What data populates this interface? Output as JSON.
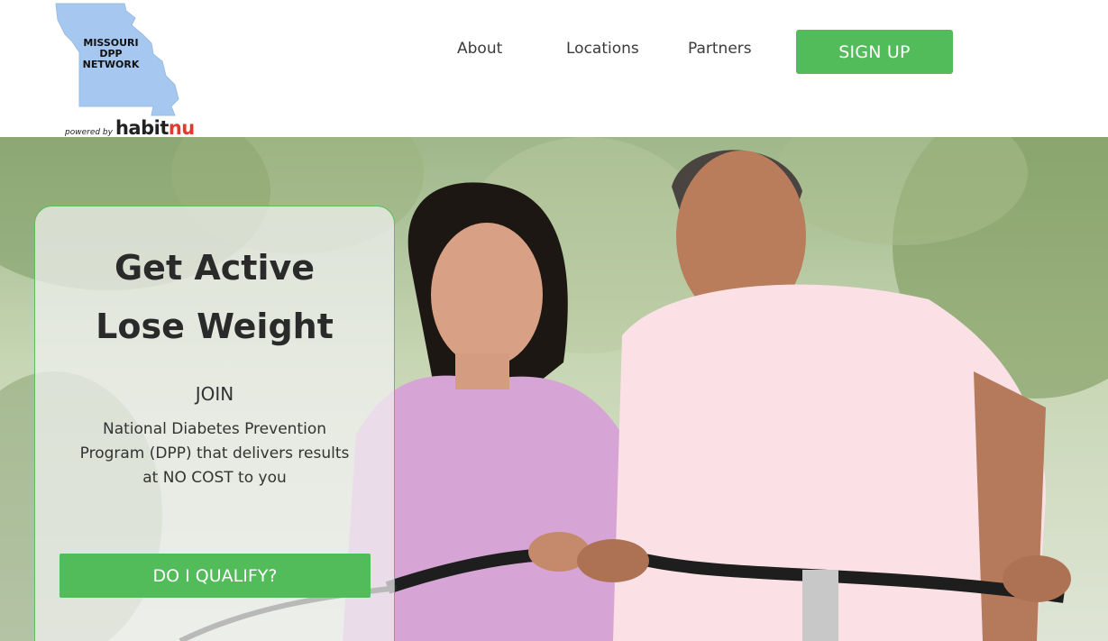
{
  "logo": {
    "lines": [
      "MISSOURI",
      "DPP",
      "NETWORK"
    ],
    "powered_prefix": "powered by",
    "brand_main": "habit",
    "brand_accent": "nu"
  },
  "nav": {
    "items": [
      {
        "label": "About"
      },
      {
        "label": "Locations"
      },
      {
        "label": "Partners"
      }
    ],
    "signup_label": "SIGN UP"
  },
  "hero": {
    "headline": [
      "Get Active",
      "Lose Weight"
    ],
    "join": "JOIN",
    "description": [
      "National Diabetes Prevention",
      "Program (DPP) that delivers results",
      "at NO COST to you"
    ],
    "cta_label": "DO I QUALIFY?"
  },
  "colors": {
    "accent_green": "#52bc5a",
    "map_blue": "#a6c8f0",
    "brand_red": "#e23a2c"
  },
  "icons": [
    "missouri-map-icon"
  ]
}
